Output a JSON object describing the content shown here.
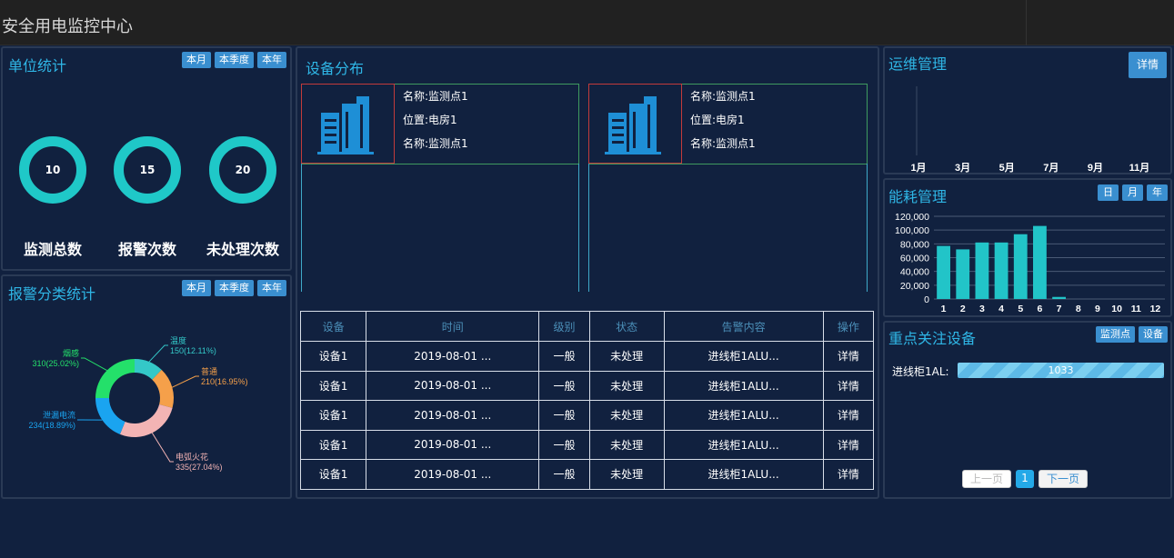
{
  "app_title": "安全用电监控中心",
  "unit_stats": {
    "title": "单位统计",
    "buttons": [
      "本月",
      "本季度",
      "本年"
    ],
    "rings": [
      {
        "value": "10",
        "label": "监测总数"
      },
      {
        "value": "15",
        "label": "报警次数"
      },
      {
        "value": "20",
        "label": "未处理次数"
      }
    ]
  },
  "alarm_stats": {
    "title": "报警分类统计",
    "buttons": [
      "本月",
      "本季度",
      "本年"
    ],
    "chart_data": {
      "type": "pie",
      "slices": [
        {
          "name": "温度",
          "label": "150(12.11%)",
          "value": 150,
          "percent": 12.11,
          "color": "#34c8c8"
        },
        {
          "name": "普通",
          "label": "210(16.95%)",
          "value": 210,
          "percent": 16.95,
          "color": "#f5a04a"
        },
        {
          "name": "电弧火花",
          "label": "335(27.04%)",
          "value": 335,
          "percent": 27.04,
          "color": "#f3b4b4"
        },
        {
          "name": "泄漏电流",
          "label": "234(18.89%)",
          "value": 234,
          "percent": 18.89,
          "color": "#1aa4f0"
        },
        {
          "name": "烟感",
          "label": "310(25.02%)",
          "value": 310,
          "percent": 25.02,
          "color": "#24e06a"
        }
      ]
    }
  },
  "device_dist": {
    "title": "设备分布",
    "cards": [
      {
        "name": "名称:监测点1",
        "location": "位置:电房1",
        "name2": "名称:监测点1"
      },
      {
        "name": "名称:监测点1",
        "location": "位置:电房1",
        "name2": "名称:监测点1"
      }
    ],
    "table": {
      "headers": [
        "设备",
        "时间",
        "级别",
        "状态",
        "告警内容",
        "操作"
      ],
      "rows": [
        [
          "设备1",
          "2019-08-01 ...",
          "一般",
          "未处理",
          "进线柜1ALU...",
          "详情"
        ],
        [
          "设备1",
          "2019-08-01 ...",
          "一般",
          "未处理",
          "进线柜1ALU...",
          "详情"
        ],
        [
          "设备1",
          "2019-08-01 ...",
          "一般",
          "未处理",
          "进线柜1ALU...",
          "详情"
        ],
        [
          "设备1",
          "2019-08-01 ...",
          "一般",
          "未处理",
          "进线柜1ALU...",
          "详情"
        ],
        [
          "设备1",
          "2019-08-01 ...",
          "一般",
          "未处理",
          "进线柜1ALU...",
          "详情"
        ]
      ]
    }
  },
  "ops": {
    "title": "运维管理",
    "detail_button": "详情",
    "chart_data": {
      "type": "line",
      "x_ticks": [
        "1月",
        "3月",
        "5月",
        "7月",
        "9月",
        "11月"
      ],
      "series": []
    }
  },
  "energy": {
    "title": "能耗管理",
    "buttons": [
      "日",
      "月",
      "年"
    ],
    "chart_data": {
      "type": "bar",
      "categories": [
        "1",
        "2",
        "3",
        "4",
        "5",
        "6",
        "7",
        "8",
        "9",
        "10",
        "11",
        "12"
      ],
      "values": [
        77000,
        72000,
        82000,
        82000,
        94000,
        106000,
        3000,
        0,
        0,
        0,
        0,
        0
      ],
      "y_ticks": [
        "120,000",
        "100,000",
        "80,000",
        "60,000",
        "40,000",
        "20,000",
        "0"
      ],
      "ylim": [
        0,
        120000
      ]
    }
  },
  "focus": {
    "title": "重点关注设备",
    "buttons": [
      "监测点",
      "设备"
    ],
    "item_label": "进线柜1AL:",
    "item_value": "1033",
    "pager": {
      "prev": "上一页",
      "page": "1",
      "next": "下一页"
    }
  }
}
